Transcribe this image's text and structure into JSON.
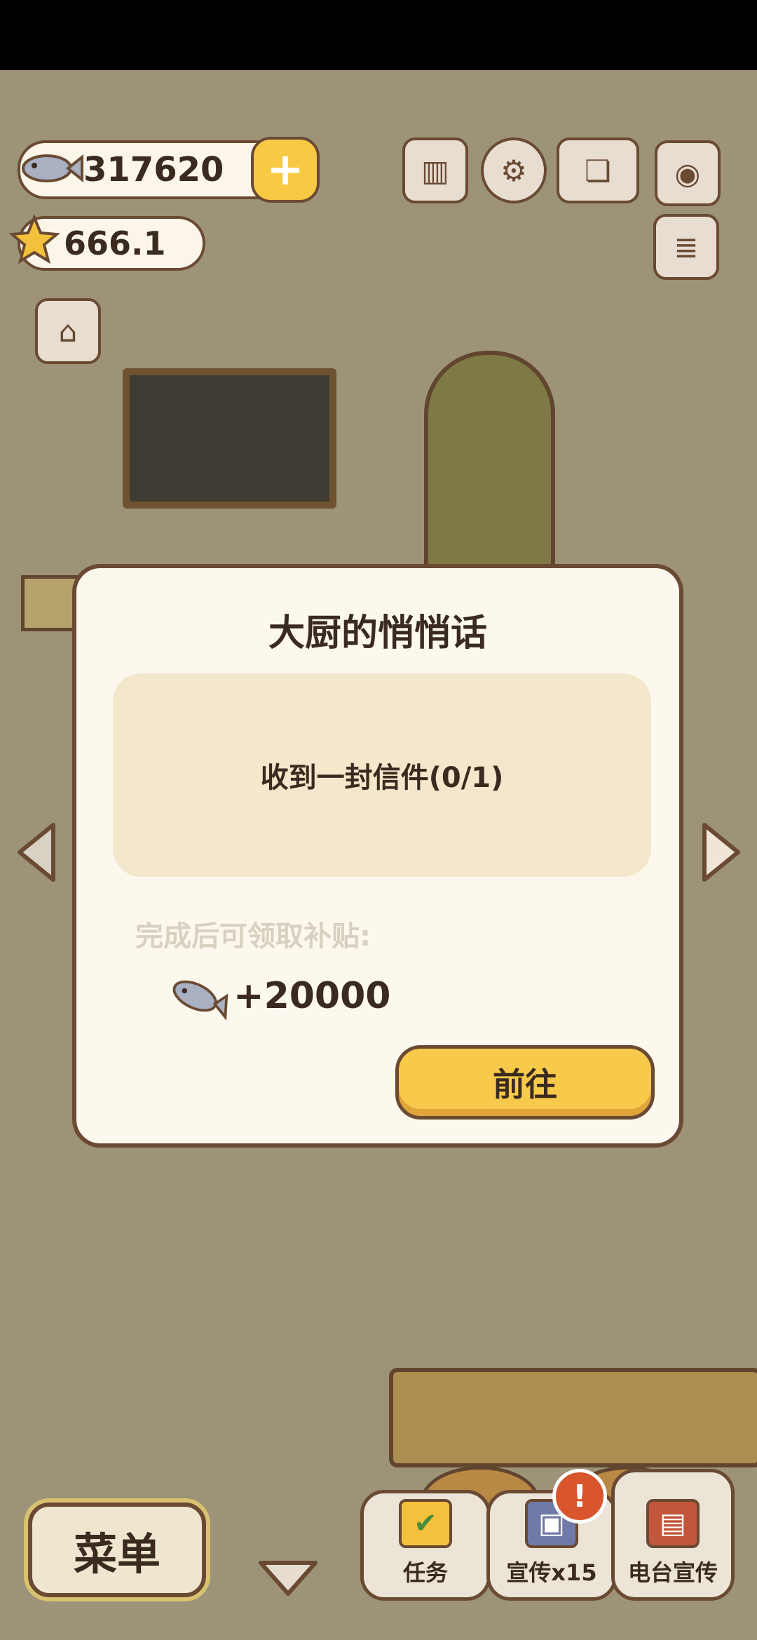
{
  "currency": {
    "fish_amount": "317620",
    "star_amount": "666.1"
  },
  "top_icons": [
    "ranking-icon",
    "gear-icon",
    "recipe-book-icon",
    "camera-icon",
    "news-icon",
    "shop-icon"
  ],
  "modal": {
    "title": "大厨的悄悄话",
    "task_text": "收到一封信件(0/1)",
    "reward_label": "完成后可领取补贴:",
    "reward_amount": "+20000",
    "go_button": "前往"
  },
  "bottom_bar": {
    "menu_label": "菜单",
    "tasks_label": "任务",
    "promote_label": "宣传x15",
    "radio_label": "电台宣传",
    "alert_badge": "!"
  },
  "colors": {
    "accent_yellow": "#f8ca4c",
    "outline_brown": "#6a4a33",
    "alert_red": "#d9552e"
  }
}
